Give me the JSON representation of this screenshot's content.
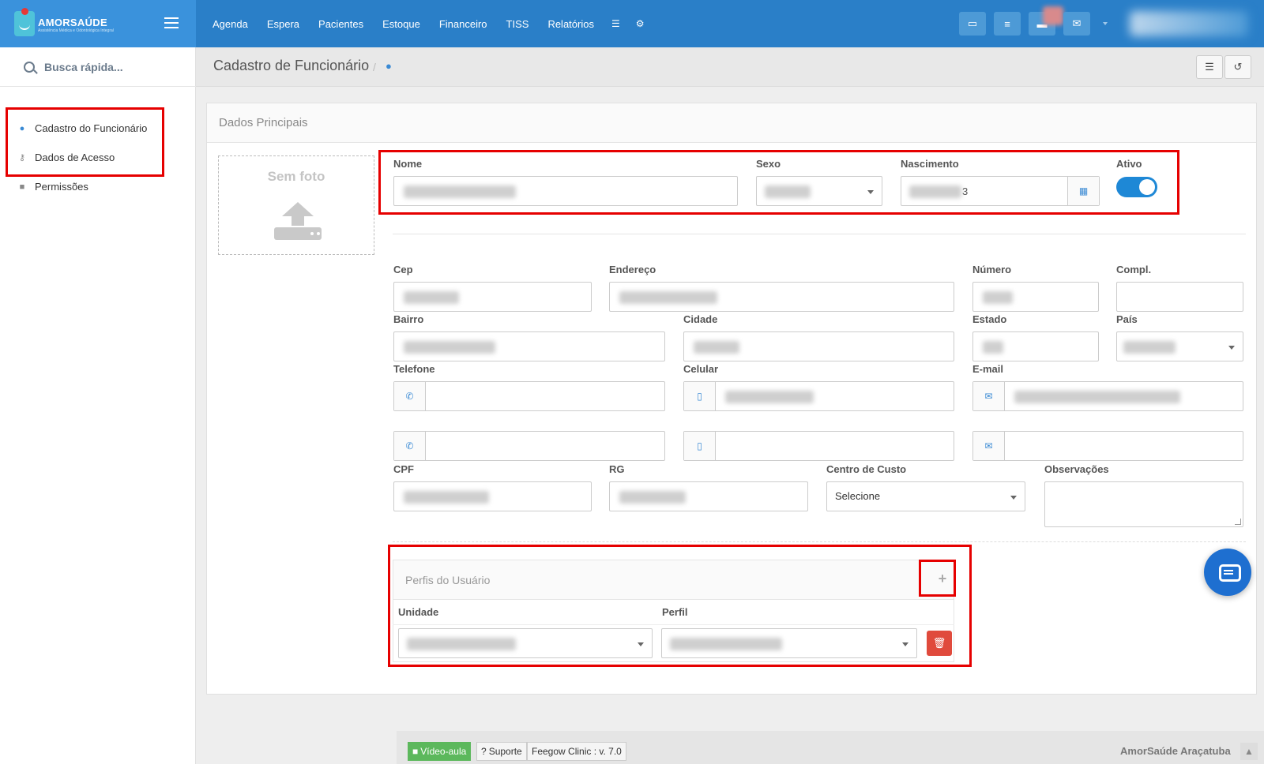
{
  "brand": {
    "name": "AMORSAÚDE",
    "tagline": "Assistência Médica e Odontológica Integral"
  },
  "nav": {
    "items": [
      "Agenda",
      "Espera",
      "Pacientes",
      "Estoque",
      "Financeiro",
      "TISS",
      "Relatórios"
    ]
  },
  "sidebar": {
    "search_placeholder": "Busca rápida...",
    "items": [
      {
        "label": "Cadastro do Funcionário",
        "icon": "user-icon"
      },
      {
        "label": "Dados de Acesso",
        "icon": "key-icon"
      },
      {
        "label": "Permissões",
        "icon": "lock-icon"
      }
    ]
  },
  "page": {
    "title": "Cadastro de Funcionário",
    "separator": "/"
  },
  "panel": {
    "title": "Dados Principais"
  },
  "photo": {
    "label": "Sem foto"
  },
  "form": {
    "nome": "Nome",
    "sexo": "Sexo",
    "nascimento": "Nascimento",
    "nascimento_suffix": "3",
    "ativo": "Ativo",
    "ativo_on": true,
    "cep": "Cep",
    "endereco": "Endereço",
    "numero": "Número",
    "compl": "Compl.",
    "bairro": "Bairro",
    "cidade": "Cidade",
    "estado": "Estado",
    "pais": "País",
    "telefone": "Telefone",
    "celular": "Celular",
    "email": "E-mail",
    "cpf": "CPF",
    "rg": "RG",
    "centro_custo": "Centro de Custo",
    "centro_custo_value": "Selecione",
    "observacoes": "Observações"
  },
  "perfis": {
    "title": "Perfis do Usuário",
    "col_unidade": "Unidade",
    "col_perfil": "Perfil"
  },
  "footer": {
    "video": "Vídeo-aula",
    "suporte": "Suporte",
    "version": "Feegow Clinic : v. 7.0",
    "clinic": "AmorSaúde Araçatuba"
  },
  "colors": {
    "topbar": "#2a7fc8",
    "accent": "#1e88d6",
    "highlight": "#e60000",
    "danger": "#e04a3c"
  }
}
